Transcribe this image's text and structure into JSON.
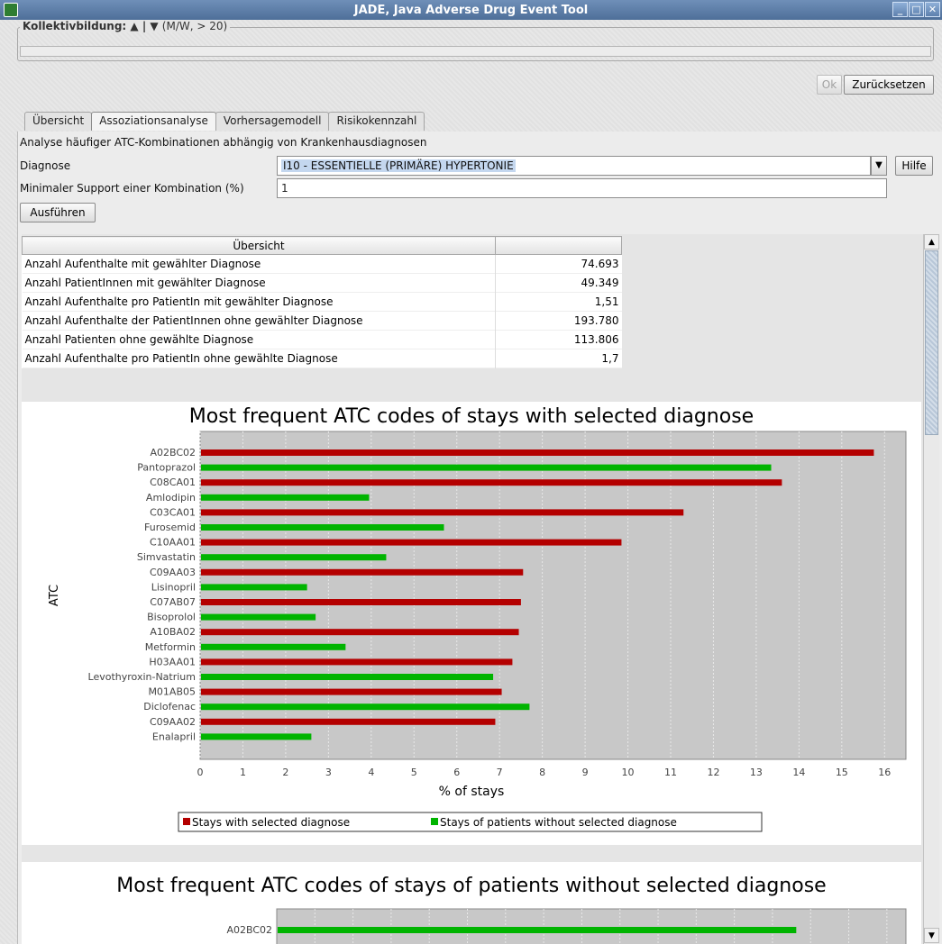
{
  "window": {
    "title": "JADE, Java Adverse Drug Event Tool"
  },
  "group": {
    "label": "Kollektivbildung: ▲ | ▼",
    "hint": "(M/W, > 20)"
  },
  "buttons": {
    "ok": "Ok",
    "reset": "Zurücksetzen",
    "help": "Hilfe",
    "run": "Ausführen"
  },
  "tabs": [
    "Übersicht",
    "Assoziationsanalyse",
    "Vorhersagemodell",
    "Risikokennzahl"
  ],
  "form": {
    "subtitle": "Analyse häufiger ATC-Kombinationen abhängig von Krankenhausdiagnosen",
    "diagnosis_label": "Diagnose",
    "diagnosis_value": "I10 - ESSENTIELLE (PRIMÄRE) HYPERTONIE",
    "support_label": "Minimaler Support einer Kombination (%)",
    "support_value": "1"
  },
  "summary_table": {
    "header": "Übersicht",
    "rows": [
      {
        "label": "Anzahl Aufenthalte mit gewählter Diagnose",
        "value": "74.693"
      },
      {
        "label": "Anzahl PatientInnen mit gewählter Diagnose",
        "value": "49.349"
      },
      {
        "label": "Anzahl Aufenthalte pro PatientIn mit gewählter Diagnose",
        "value": "1,51"
      },
      {
        "label": "Anzahl Aufenthalte der PatientInnen ohne gewählter Diagnose",
        "value": "193.780"
      },
      {
        "label": "Anzahl Patienten ohne gewählte Diagnose",
        "value": "113.806"
      },
      {
        "label": "Anzahl Aufenthalte pro PatientIn ohne gewählte Diagnose",
        "value": "1,7"
      }
    ]
  },
  "colors": {
    "series1": "#b40000",
    "series2": "#00b400",
    "plot_bg": "#c8c8c8"
  },
  "chart_data": [
    {
      "type": "bar",
      "orientation": "horizontal",
      "title": "Most frequent ATC codes of stays with selected diagnose",
      "xlabel": "% of stays",
      "ylabel": "ATC",
      "xlim": [
        0,
        16.5
      ],
      "xticks": [
        0,
        1,
        2,
        3,
        4,
        5,
        6,
        7,
        8,
        9,
        10,
        11,
        12,
        13,
        14,
        15,
        16
      ],
      "categories": [
        "A02BC02",
        "Pantoprazol",
        "C08CA01",
        "Amlodipin",
        "C03CA01",
        "Furosemid",
        "C10AA01",
        "Simvastatin",
        "C09AA03",
        "Lisinopril",
        "C07AB07",
        "Bisoprolol",
        "A10BA02",
        "Metformin",
        "H03AA01",
        "Levothyroxin-Natrium",
        "M01AB05",
        "Diclofenac",
        "C09AA02",
        "Enalapril"
      ],
      "bars": [
        {
          "series": 0,
          "value": 15.75
        },
        {
          "series": 1,
          "value": 13.35
        },
        {
          "series": 0,
          "value": 13.6
        },
        {
          "series": 1,
          "value": 3.95
        },
        {
          "series": 0,
          "value": 11.3
        },
        {
          "series": 1,
          "value": 5.7
        },
        {
          "series": 0,
          "value": 9.85
        },
        {
          "series": 1,
          "value": 4.35
        },
        {
          "series": 0,
          "value": 7.55
        },
        {
          "series": 1,
          "value": 2.5
        },
        {
          "series": 0,
          "value": 7.5
        },
        {
          "series": 1,
          "value": 2.7
        },
        {
          "series": 0,
          "value": 7.45
        },
        {
          "series": 1,
          "value": 3.4
        },
        {
          "series": 0,
          "value": 7.3
        },
        {
          "series": 1,
          "value": 6.85
        },
        {
          "series": 0,
          "value": 7.05
        },
        {
          "series": 1,
          "value": 7.7
        },
        {
          "series": 0,
          "value": 6.9
        },
        {
          "series": 1,
          "value": 2.6
        }
      ],
      "series": [
        {
          "name": "Stays with selected diagnose"
        },
        {
          "name": "Stays of patients without selected diagnose"
        }
      ],
      "legend": "bottom",
      "grid": true
    },
    {
      "type": "bar",
      "orientation": "horizontal",
      "title": "Most frequent ATC codes of stays of patients without selected diagnose",
      "xlim": [
        0,
        16.5
      ],
      "categories": [
        "A02BC02"
      ],
      "bars": [
        {
          "series": 1,
          "value": 13.6
        }
      ]
    }
  ]
}
